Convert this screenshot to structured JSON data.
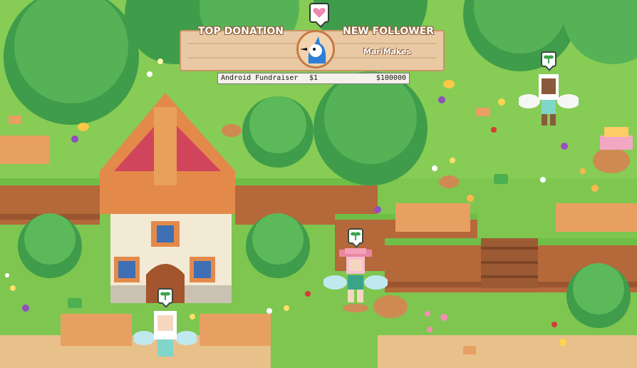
{
  "overlay": {
    "top_donation_label": "TOP DONATION",
    "new_follower_label": "NEW FOLLOWER",
    "follower_name": "MariMakes",
    "fundraiser": {
      "name": "Android Fundraiser",
      "amount": "$1",
      "goal": "$100000"
    }
  },
  "colors": {
    "grass": "#7ec650",
    "cliff": "#b5683a",
    "path": "#e8c08a",
    "roof": "#d1455c",
    "tree": "#3f9c4a"
  },
  "icons": {
    "heart": "heart-icon",
    "sprout": "sprout-icon",
    "bluejay": "bluejay-avatar"
  }
}
